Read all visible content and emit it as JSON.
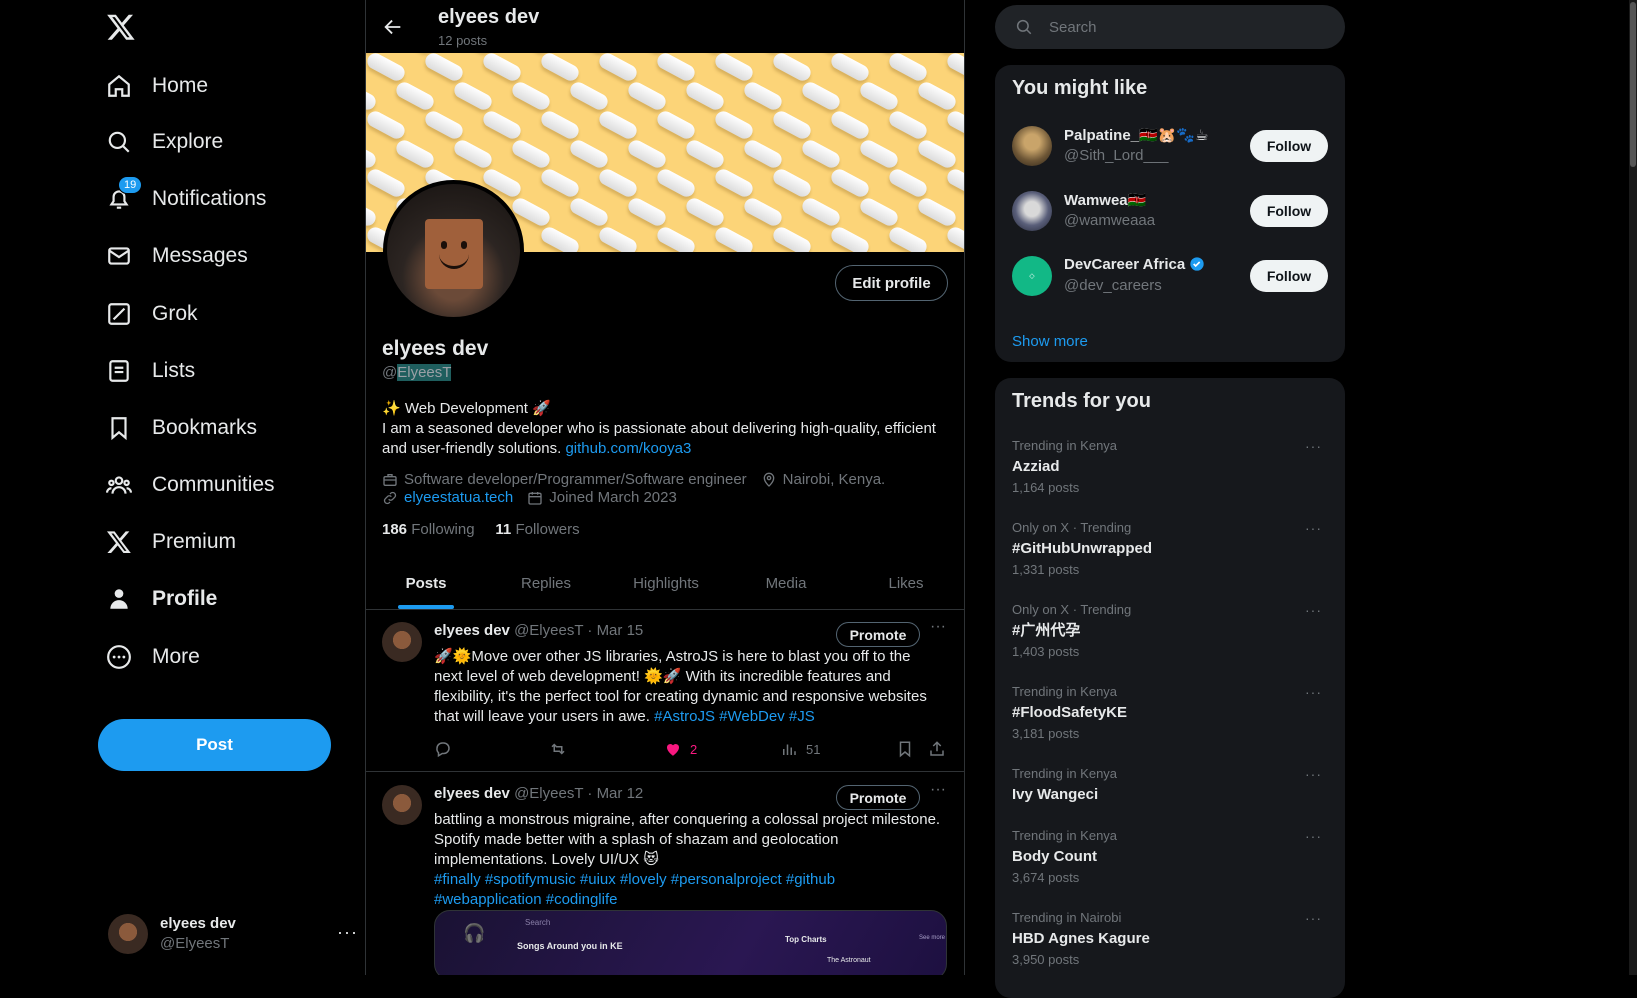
{
  "nav": {
    "items": [
      {
        "label": "Home",
        "icon": "home-icon"
      },
      {
        "label": "Explore",
        "icon": "search-icon"
      },
      {
        "label": "Notifications",
        "icon": "bell-icon",
        "badge": "19"
      },
      {
        "label": "Messages",
        "icon": "envelope-icon"
      },
      {
        "label": "Grok",
        "icon": "grok-icon"
      },
      {
        "label": "Lists",
        "icon": "list-icon"
      },
      {
        "label": "Bookmarks",
        "icon": "bookmark-icon"
      },
      {
        "label": "Communities",
        "icon": "people-icon"
      },
      {
        "label": "Premium",
        "icon": "x-logo-icon"
      },
      {
        "label": "Profile",
        "icon": "person-icon",
        "active": true
      },
      {
        "label": "More",
        "icon": "more-circle-icon"
      }
    ],
    "post_label": "Post",
    "account": {
      "name": "elyees dev",
      "handle": "@ElyeesT",
      "more": "···"
    }
  },
  "profile": {
    "top_name": "elyees dev",
    "top_posts": "12 posts",
    "edit_label": "Edit profile",
    "name": "elyees dev",
    "handle_at": "@",
    "handle_sel": "ElyeesT",
    "bio_line1": "✨ Web Development 🚀",
    "bio_line2": "I am a seasoned developer who is passionate about delivering high-quality, efficient and user-friendly solutions. ",
    "bio_link": "github.com/kooya3",
    "profession": "Software developer/Programmer/Software engineer",
    "location": "Nairobi, Kenya.",
    "website": "elyeestatua.tech",
    "joined": "Joined March 2023",
    "following_count": "186",
    "following_label": "Following",
    "followers_count": "11",
    "followers_label": "Followers"
  },
  "tabs": [
    "Posts",
    "Replies",
    "Highlights",
    "Media",
    "Likes"
  ],
  "tweets": [
    {
      "name": "elyees dev",
      "handle": "@ElyeesT",
      "sep": "·",
      "date": "Mar 15",
      "promote": "Promote",
      "text": "🚀🌞Move over other JS libraries, AstroJS is here to blast you off to the next level of web development! 🌞🚀 With its incredible features and flexibility, it's the perfect tool for creating dynamic and responsive websites that will leave your users in awe. ",
      "tags": "#AstroJS #WebDev #JS",
      "likes": "2",
      "views": "51"
    },
    {
      "name": "elyees dev",
      "handle": "@ElyeesT",
      "sep": "·",
      "date": "Mar 12",
      "promote": "Promote",
      "text": "battling a monstrous migraine, after conquering a colossal project milestone. Spotify made better with a splash of shazam and geolocation implementations. Lovely UI/UX 😻",
      "tags": "#finally #spotifymusic #uiux #lovely #personalproject #github #webapplication #codinglife",
      "media_title": "Songs Around you in KE",
      "media_right": "Top Charts",
      "media_see": "See more",
      "media_search": "Search",
      "media_track": "The Astronaut"
    }
  ],
  "search": {
    "placeholder": "Search"
  },
  "who": {
    "title": "You might like",
    "users": [
      {
        "name": "Palpatine_🇰🇪🐹🐾☕",
        "handle": "@Sith_Lord___",
        "follow": "Follow"
      },
      {
        "name": "Wamwea🇰🇪",
        "handle": "@wamweaaa",
        "follow": "Follow"
      },
      {
        "name": "DevCareer Africa",
        "handle": "@dev_careers",
        "follow": "Follow",
        "verified": true
      }
    ],
    "show_more": "Show more"
  },
  "trends": {
    "title": "Trends for you",
    "items": [
      {
        "context": "Trending in Kenya",
        "name": "Azziad",
        "count": "1,164 posts"
      },
      {
        "context": "Only on X · Trending",
        "name": "#GitHubUnwrapped",
        "count": "1,331 posts"
      },
      {
        "context": "Only on X · Trending",
        "name": "#广州代孕",
        "count": "1,403 posts"
      },
      {
        "context": "Trending in Kenya",
        "name": "#FloodSafetyKE",
        "count": "3,181 posts"
      },
      {
        "context": "Trending in Kenya",
        "name": "Ivy Wangeci",
        "count": ""
      },
      {
        "context": "Trending in Kenya",
        "name": "Body Count",
        "count": "3,674 posts"
      },
      {
        "context": "Trending in Nairobi",
        "name": "HBD Agnes Kagure",
        "count": "3,950 posts"
      }
    ]
  },
  "colors": {
    "accent": "#1d9bf0",
    "like": "#f91880",
    "banner": "#fcd478"
  }
}
